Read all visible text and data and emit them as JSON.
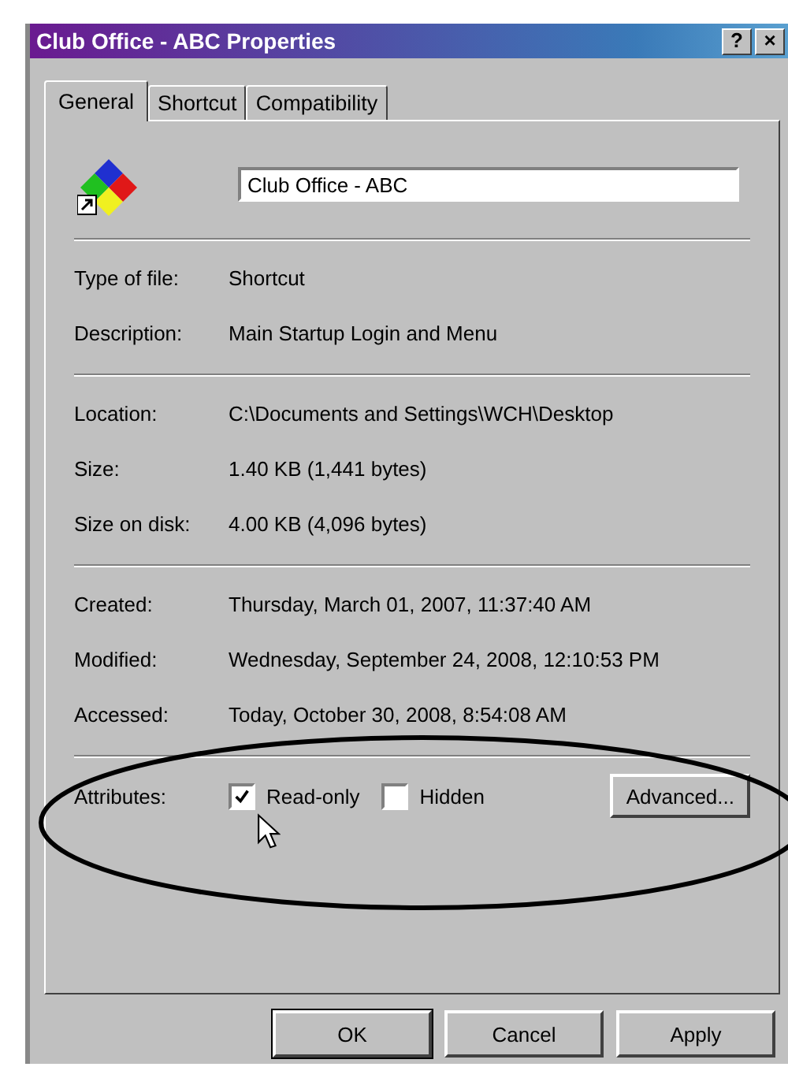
{
  "window": {
    "title": "Club Office - ABC Properties",
    "title_buttons": [
      "?",
      "×"
    ]
  },
  "tabs": [
    {
      "label": "General",
      "selected": true
    },
    {
      "label": "Shortcut",
      "selected": false
    },
    {
      "label": "Compatibility",
      "selected": false
    }
  ],
  "name_field": {
    "value": "Club Office - ABC"
  },
  "sections": [
    [
      {
        "label": "Type of file:",
        "value": "Shortcut"
      },
      {
        "label": "Description:",
        "value": "Main Startup Login and Menu"
      }
    ],
    [
      {
        "label": "Location:",
        "value": "C:\\Documents and Settings\\WCH\\Desktop"
      },
      {
        "label": "Size:",
        "value": "1.40 KB (1,441 bytes)"
      },
      {
        "label": "Size on disk:",
        "value": "4.00 KB (4,096 bytes)"
      }
    ],
    [
      {
        "label": "Created:",
        "value": "Thursday, March 01, 2007, 11:37:40 AM"
      },
      {
        "label": "Modified:",
        "value": "Wednesday, September 24, 2008, 12:10:53 PM"
      },
      {
        "label": "Accessed:",
        "value": "Today, October 30, 2008, 8:54:08 AM"
      }
    ]
  ],
  "attributes": {
    "label": "Attributes:",
    "checkboxes": [
      {
        "label": "Read-only",
        "checked": true
      },
      {
        "label": "Hidden",
        "checked": false
      }
    ],
    "advanced_button": "Advanced..."
  },
  "buttons": [
    "OK",
    "Cancel",
    "Apply"
  ]
}
